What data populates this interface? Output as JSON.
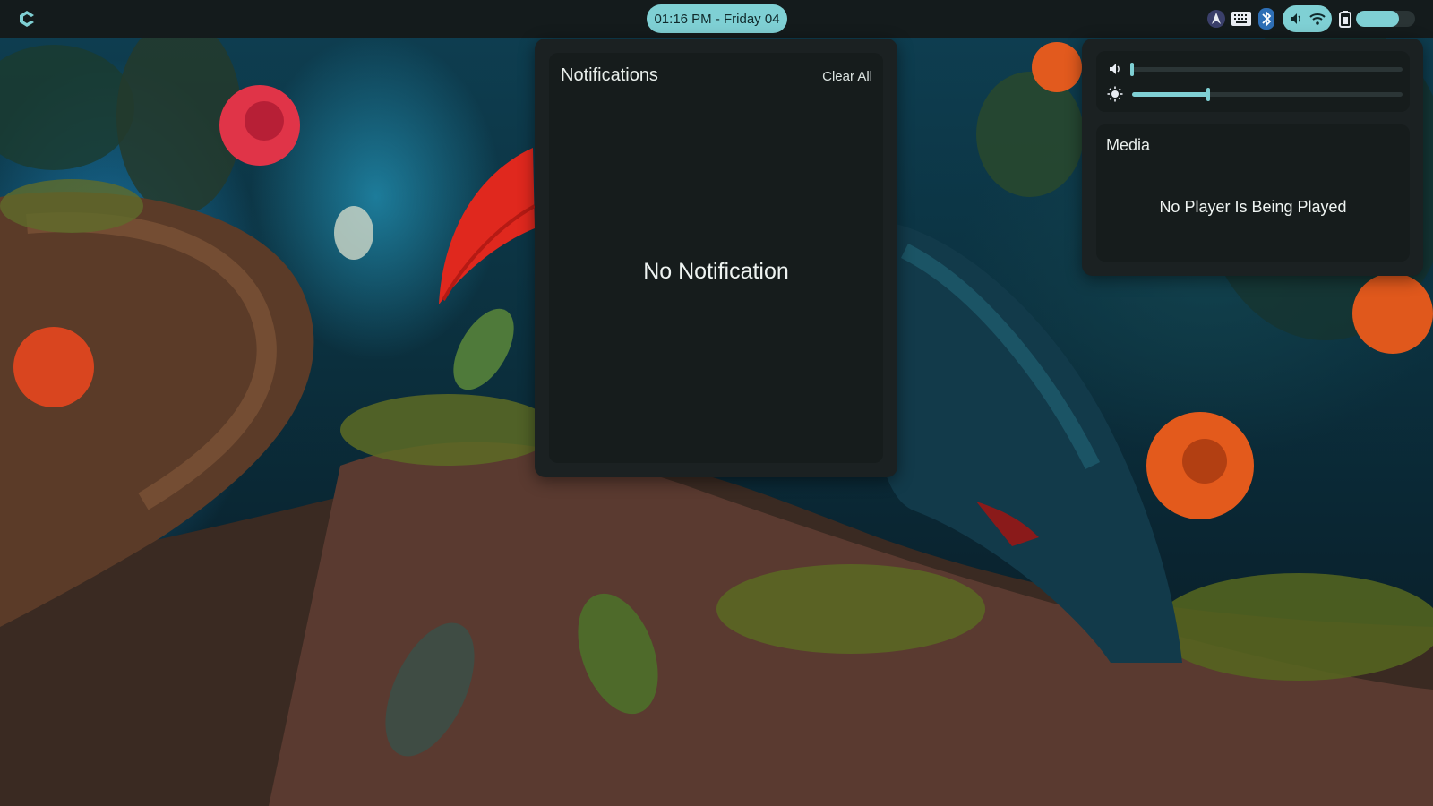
{
  "topbar": {
    "launcher_icon": "app-launcher-icon",
    "clock_text": "01:16 PM - Friday 04",
    "tray_icons": [
      "vpn-icon",
      "keyboard-icon",
      "bluetooth-icon"
    ],
    "quick_pill_icons": [
      "volume-icon",
      "wifi-icon"
    ],
    "battery_level": 0.72,
    "accent_color": "#7fd0d4"
  },
  "notifications": {
    "title": "Notifications",
    "clear_all_label": "Clear All",
    "empty_text": "No Notification"
  },
  "quick_settings": {
    "volume_level": 0.0,
    "brightness_level": 0.28,
    "media": {
      "title": "Media",
      "empty_text": "No Player Is Being Played"
    }
  },
  "colors": {
    "panel_bg": "#1b2122",
    "panel_inner_bg": "#161c1c",
    "bar_bg": "#141b1c"
  }
}
